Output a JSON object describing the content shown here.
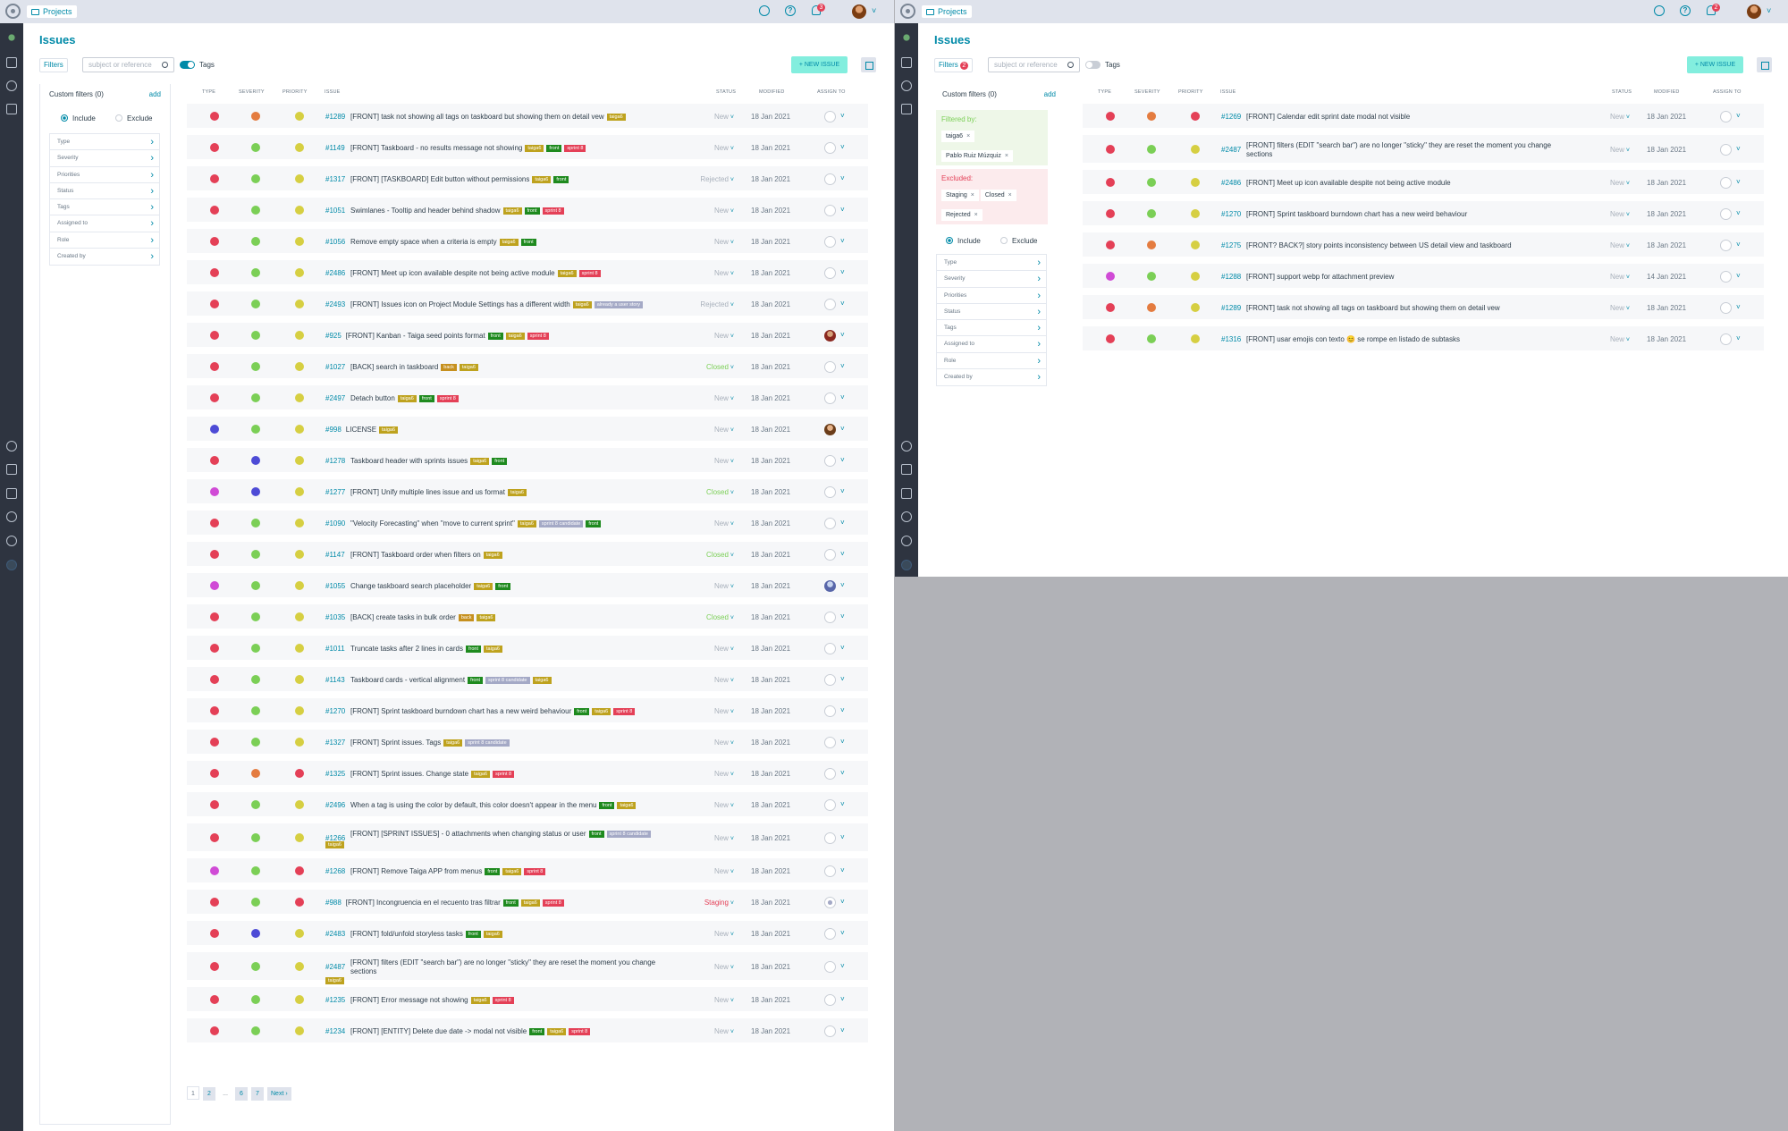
{
  "topbar": {
    "breadcrumb": "Projects",
    "notif_p1": "3",
    "notif_p2": "2"
  },
  "page_title": "Issues",
  "filters_label": "Filters",
  "filters_count_p2": "2",
  "search": {
    "placeholder": "subject or reference"
  },
  "tags_label": "Tags",
  "new_issue_label": "+ NEW ISSUE",
  "custom_filters_label": "Custom filters (0)",
  "add_label": "add",
  "include_label": "Include",
  "exclude_label": "Exclude",
  "filter_items": [
    "Type",
    "Severity",
    "Priorities",
    "Status",
    "Tags",
    "Assigned to",
    "Role",
    "Created by"
  ],
  "filtered_by_label": "Filtered by:",
  "filtered_by": [
    "taiga6",
    "Pablo Ruiz Múzquiz"
  ],
  "excluded_label": "Excluded:",
  "excluded": [
    "Staging",
    "Closed",
    "Rejected"
  ],
  "columns": {
    "type": "TYPE",
    "severity": "SEVERITY",
    "priority": "PRIORITY",
    "issue": "ISSUE",
    "status": "STATUS",
    "modified": "MODIFIED",
    "assigned": "ASSIGN TO"
  },
  "colors": {
    "red": "#e44057",
    "orange": "#e47c40",
    "green": "#7bcf56",
    "yellow": "#d6cf42",
    "blue": "#4d4bd6",
    "purple": "#d04bd6",
    "accent": "#008aa8",
    "tag_olive": "#bea21e",
    "tag_green": "#1e8a1e",
    "tag_pink": "#e44057",
    "tag_gray": "#a4a9c6",
    "tag_orange": "#c6901e"
  },
  "issues_p1": [
    {
      "type": "red",
      "sev": "orange",
      "pri": "yellow",
      "ref": "#1289",
      "subject": "[FRONT] task not showing all tags on taskboard but showing them on detail vew",
      "tags": [
        [
          "taiga6",
          "tag_olive"
        ]
      ],
      "status": "New",
      "date": "18 Jan 2021",
      "assignee": "empty"
    },
    {
      "type": "red",
      "sev": "green",
      "pri": "yellow",
      "ref": "#1149",
      "subject": "[FRONT] Taskboard - no results message not showing",
      "tags": [
        [
          "taiga6",
          "tag_olive"
        ],
        [
          "front",
          "tag_green"
        ],
        [
          "sprint 8",
          "tag_pink"
        ]
      ],
      "status": "New",
      "date": "18 Jan 2021",
      "assignee": "empty"
    },
    {
      "type": "red",
      "sev": "green",
      "pri": "yellow",
      "ref": "#1317",
      "subject": "[FRONT] [TASKBOARD] Edit button without permissions",
      "tags": [
        [
          "taiga6",
          "tag_olive"
        ],
        [
          "front",
          "tag_green"
        ]
      ],
      "status": "Rejected",
      "date": "18 Jan 2021",
      "assignee": "empty"
    },
    {
      "type": "red",
      "sev": "green",
      "pri": "yellow",
      "ref": "#1051",
      "subject": "Swimlanes - Tooltip and header behind shadow",
      "tags": [
        [
          "taiga6",
          "tag_olive"
        ],
        [
          "front",
          "tag_green"
        ],
        [
          "sprint 8",
          "tag_pink"
        ]
      ],
      "status": "New",
      "date": "18 Jan 2021",
      "assignee": "empty"
    },
    {
      "type": "red",
      "sev": "green",
      "pri": "yellow",
      "ref": "#1056",
      "subject": "Remove empty space when a criteria is empty",
      "tags": [
        [
          "taiga6",
          "tag_olive"
        ],
        [
          "front",
          "tag_green"
        ]
      ],
      "status": "New",
      "date": "18 Jan 2021",
      "assignee": "empty"
    },
    {
      "type": "red",
      "sev": "green",
      "pri": "yellow",
      "ref": "#2486",
      "subject": "[FRONT] Meet up icon available despite not being active module",
      "tags": [
        [
          "taiga6",
          "tag_olive"
        ],
        [
          "sprint 8",
          "tag_pink"
        ]
      ],
      "status": "New",
      "date": "18 Jan 2021",
      "assignee": "empty"
    },
    {
      "type": "red",
      "sev": "green",
      "pri": "yellow",
      "ref": "#2493",
      "subject": "[FRONT] Issues icon on Project Module Settings has a different width",
      "tags": [
        [
          "taiga6",
          "tag_olive"
        ],
        [
          "already a user story",
          "tag_gray"
        ]
      ],
      "status": "Rejected",
      "date": "18 Jan 2021",
      "assignee": "empty"
    },
    {
      "type": "red",
      "sev": "green",
      "pri": "yellow",
      "ref": "#925",
      "subject": "[FRONT] Kanban - Taiga seed points format",
      "tags": [
        [
          "front",
          "tag_green"
        ],
        [
          "taiga6",
          "tag_olive"
        ],
        [
          "sprint 8",
          "tag_pink"
        ]
      ],
      "status": "New",
      "date": "18 Jan 2021",
      "assignee": "img"
    },
    {
      "type": "red",
      "sev": "green",
      "pri": "yellow",
      "ref": "#1027",
      "subject": "[BACK] search in taskboard",
      "tags": [
        [
          "back",
          "tag_orange"
        ],
        [
          "taiga6",
          "tag_olive"
        ]
      ],
      "status": "Closed",
      "date": "18 Jan 2021",
      "assignee": "empty"
    },
    {
      "type": "red",
      "sev": "green",
      "pri": "yellow",
      "ref": "#2497",
      "subject": "Detach button",
      "tags": [
        [
          "taiga6",
          "tag_olive"
        ],
        [
          "front",
          "tag_green"
        ],
        [
          "sprint 8",
          "tag_pink"
        ]
      ],
      "status": "New",
      "date": "18 Jan 2021",
      "assignee": "empty"
    },
    {
      "type": "blue",
      "sev": "green",
      "pri": "yellow",
      "ref": "#998",
      "subject": "LICENSE",
      "tags": [
        [
          "taiga6",
          "tag_olive"
        ]
      ],
      "status": "New",
      "date": "18 Jan 2021",
      "assignee": "img2"
    },
    {
      "type": "red",
      "sev": "blue",
      "pri": "yellow",
      "ref": "#1278",
      "subject": "Taskboard header with sprints issues",
      "tags": [
        [
          "taiga6",
          "tag_olive"
        ],
        [
          "front",
          "tag_green"
        ]
      ],
      "status": "New",
      "date": "18 Jan 2021",
      "assignee": "empty"
    },
    {
      "type": "purple",
      "sev": "blue",
      "pri": "yellow",
      "ref": "#1277",
      "subject": "[FRONT] Unify multiple lines issue and us format",
      "tags": [
        [
          "taiga6",
          "tag_olive"
        ]
      ],
      "status": "Closed",
      "date": "18 Jan 2021",
      "assignee": "empty"
    },
    {
      "type": "red",
      "sev": "green",
      "pri": "yellow",
      "ref": "#1090",
      "subject": "\"Velocity Forecasting\" when \"move to current sprint\"",
      "tags": [
        [
          "taiga6",
          "tag_olive"
        ],
        [
          "sprint 8 candidate",
          "tag_gray"
        ],
        [
          "front",
          "tag_green"
        ]
      ],
      "status": "New",
      "date": "18 Jan 2021",
      "assignee": "empty"
    },
    {
      "type": "red",
      "sev": "green",
      "pri": "yellow",
      "ref": "#1147",
      "subject": "[FRONT] Taskboard order when filters on",
      "tags": [
        [
          "taiga6",
          "tag_olive"
        ]
      ],
      "status": "Closed",
      "date": "18 Jan 2021",
      "assignee": "empty"
    },
    {
      "type": "purple",
      "sev": "green",
      "pri": "yellow",
      "ref": "#1055",
      "subject": "Change taskboard search placeholder",
      "tags": [
        [
          "taiga6",
          "tag_olive"
        ],
        [
          "front",
          "tag_green"
        ]
      ],
      "status": "New",
      "date": "18 Jan 2021",
      "assignee": "img3"
    },
    {
      "type": "red",
      "sev": "green",
      "pri": "yellow",
      "ref": "#1035",
      "subject": "[BACK] create tasks in bulk order",
      "tags": [
        [
          "back",
          "tag_orange"
        ],
        [
          "taiga6",
          "tag_olive"
        ]
      ],
      "status": "Closed",
      "date": "18 Jan 2021",
      "assignee": "empty"
    },
    {
      "type": "red",
      "sev": "green",
      "pri": "yellow",
      "ref": "#1011",
      "subject": "Truncate tasks after 2 lines in cards",
      "tags": [
        [
          "front",
          "tag_green"
        ],
        [
          "taiga6",
          "tag_olive"
        ]
      ],
      "status": "New",
      "date": "18 Jan 2021",
      "assignee": "empty"
    },
    {
      "type": "red",
      "sev": "green",
      "pri": "yellow",
      "ref": "#1143",
      "subject": "Taskboard cards - vertical alignment",
      "tags": [
        [
          "front",
          "tag_green"
        ],
        [
          "sprint 8 candidate",
          "tag_gray"
        ],
        [
          "taiga6",
          "tag_olive"
        ]
      ],
      "status": "New",
      "date": "18 Jan 2021",
      "assignee": "empty"
    },
    {
      "type": "red",
      "sev": "green",
      "pri": "yellow",
      "ref": "#1270",
      "subject": "[FRONT] Sprint taskboard burndown chart has a new weird behaviour",
      "tags": [
        [
          "front",
          "tag_green"
        ],
        [
          "taiga6",
          "tag_olive"
        ],
        [
          "sprint 8",
          "tag_pink"
        ]
      ],
      "status": "New",
      "date": "18 Jan 2021",
      "assignee": "empty"
    },
    {
      "type": "red",
      "sev": "green",
      "pri": "yellow",
      "ref": "#1327",
      "subject": "[FRONT] Sprint issues. Tags",
      "tags": [
        [
          "taiga6",
          "tag_olive"
        ],
        [
          "sprint 8 candidate",
          "tag_gray"
        ]
      ],
      "status": "New",
      "date": "18 Jan 2021",
      "assignee": "empty"
    },
    {
      "type": "red",
      "sev": "orange",
      "pri": "red",
      "ref": "#1325",
      "subject": "[FRONT] Sprint issues. Change state",
      "tags": [
        [
          "taiga6",
          "tag_olive"
        ],
        [
          "sprint 8",
          "tag_pink"
        ]
      ],
      "status": "New",
      "date": "18 Jan 2021",
      "assignee": "empty"
    },
    {
      "type": "red",
      "sev": "green",
      "pri": "yellow",
      "ref": "#2496",
      "subject": "When a tag is using the color by default, this color doesn't appear in the menu",
      "tags": [
        [
          "front",
          "tag_green"
        ],
        [
          "taiga6",
          "tag_olive"
        ]
      ],
      "status": "New",
      "date": "18 Jan 2021",
      "assignee": "empty"
    },
    {
      "type": "red",
      "sev": "green",
      "pri": "yellow",
      "ref": "#1266",
      "subject": "[FRONT] [SPRINT ISSUES] - 0 attachments when changing status or user",
      "tags": [
        [
          "front",
          "tag_green"
        ],
        [
          "sprint 8 candidate",
          "tag_gray"
        ]
      ],
      "tags2": [
        [
          "taiga6",
          "tag_olive"
        ]
      ],
      "status": "New",
      "date": "18 Jan 2021",
      "assignee": "empty"
    },
    {
      "type": "purple",
      "sev": "green",
      "pri": "red",
      "ref": "#1268",
      "subject": "[FRONT] Remove Taiga APP from menus",
      "tags": [
        [
          "front",
          "tag_green"
        ],
        [
          "taiga6",
          "tag_olive"
        ],
        [
          "sprint 8",
          "tag_pink"
        ]
      ],
      "status": "New",
      "date": "18 Jan 2021",
      "assignee": "empty"
    },
    {
      "type": "red",
      "sev": "green",
      "pri": "red",
      "ref": "#988",
      "subject": "[FRONT] Incongruencia en el recuento tras filtrar",
      "tags": [
        [
          "front",
          "tag_green"
        ],
        [
          "taiga6",
          "tag_olive"
        ],
        [
          "sprint 8",
          "tag_pink"
        ]
      ],
      "status": "Staging",
      "date": "18 Jan 2021",
      "assignee": "img4"
    },
    {
      "type": "red",
      "sev": "blue",
      "pri": "yellow",
      "ref": "#2483",
      "subject": "[FRONT] fold/unfold storyless tasks",
      "tags": [
        [
          "front",
          "tag_green"
        ],
        [
          "taiga6",
          "tag_olive"
        ]
      ],
      "status": "New",
      "date": "18 Jan 2021",
      "assignee": "empty"
    },
    {
      "type": "red",
      "sev": "green",
      "pri": "yellow",
      "ref": "#2487",
      "subject": "[FRONT] filters (EDIT \"search bar\") are no longer \"sticky\" they are reset the moment you change",
      "subject2": "sections",
      "tags2": [
        [
          "taiga6",
          "tag_olive"
        ]
      ],
      "status": "New",
      "date": "18 Jan 2021",
      "assignee": "empty"
    },
    {
      "type": "red",
      "sev": "green",
      "pri": "yellow",
      "ref": "#1235",
      "subject": "[FRONT] Error message not showing",
      "tags": [
        [
          "taiga6",
          "tag_olive"
        ],
        [
          "sprint 8",
          "tag_pink"
        ]
      ],
      "status": "New",
      "date": "18 Jan 2021",
      "assignee": "empty"
    },
    {
      "type": "red",
      "sev": "green",
      "pri": "yellow",
      "ref": "#1234",
      "subject": "[FRONT] [ENTITY] Delete due date -> modal not visible",
      "tags": [
        [
          "front",
          "tag_green"
        ],
        [
          "taiga6",
          "tag_olive"
        ],
        [
          "sprint 8",
          "tag_pink"
        ]
      ],
      "status": "New",
      "date": "18 Jan 2021",
      "assignee": "empty"
    }
  ],
  "issues_p2": [
    {
      "type": "red",
      "sev": "orange",
      "pri": "red",
      "ref": "#1269",
      "subject": "[FRONT] Calendar edit sprint date modal not visible",
      "status": "New",
      "date": "18 Jan 2021",
      "assignee": "empty"
    },
    {
      "type": "red",
      "sev": "green",
      "pri": "yellow",
      "ref": "#2487",
      "subject": "[FRONT] filters (EDIT \"search bar\") are no longer \"sticky\" they are reset the moment you change",
      "subject2": "sections",
      "status": "New",
      "date": "18 Jan 2021",
      "assignee": "empty"
    },
    {
      "type": "red",
      "sev": "green",
      "pri": "yellow",
      "ref": "#2486",
      "subject": "[FRONT] Meet up icon available despite not being active module",
      "status": "New",
      "date": "18 Jan 2021",
      "assignee": "empty"
    },
    {
      "type": "red",
      "sev": "green",
      "pri": "yellow",
      "ref": "#1270",
      "subject": "[FRONT] Sprint taskboard burndown chart has a new weird behaviour",
      "status": "New",
      "date": "18 Jan 2021",
      "assignee": "empty"
    },
    {
      "type": "red",
      "sev": "orange",
      "pri": "yellow",
      "ref": "#1275",
      "subject": "[FRONT? BACK?] story points inconsistency between US detail view and taskboard",
      "status": "New",
      "date": "18 Jan 2021",
      "assignee": "empty"
    },
    {
      "type": "purple",
      "sev": "green",
      "pri": "yellow",
      "ref": "#1288",
      "subject": "[FRONT] support webp for attachment preview",
      "status": "New",
      "date": "14 Jan 2021",
      "assignee": "empty"
    },
    {
      "type": "red",
      "sev": "orange",
      "pri": "yellow",
      "ref": "#1289",
      "subject": "[FRONT] task not showing all tags on taskboard but showing them on detail vew",
      "status": "New",
      "date": "18 Jan 2021",
      "assignee": "empty"
    },
    {
      "type": "red",
      "sev": "green",
      "pri": "yellow",
      "ref": "#1316",
      "subject": "[FRONT] usar emojis con texto 😊 se rompe en listado de subtasks",
      "status": "New",
      "date": "18 Jan 2021",
      "assignee": "empty"
    }
  ],
  "pagination": [
    "1",
    "2",
    "...",
    "6",
    "7",
    "Next ›"
  ]
}
